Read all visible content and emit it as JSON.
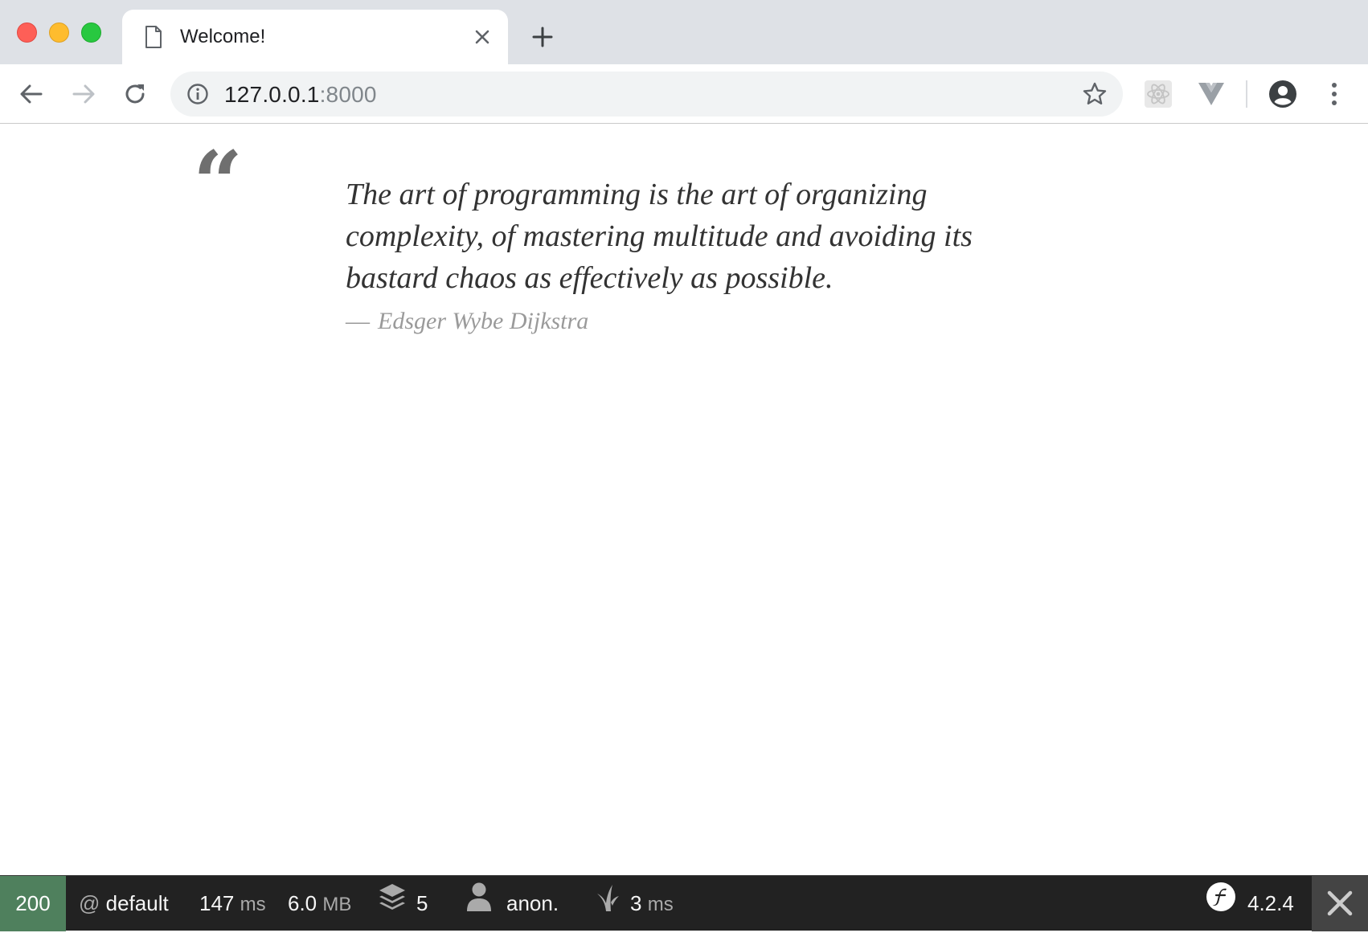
{
  "tab": {
    "title": "Welcome!"
  },
  "address_bar": {
    "host": "127.0.0.1",
    "port": ":8000"
  },
  "quote": {
    "text": "The art of programming is the art of organizing complexity, of mastering multitude and avoiding its bastard chaos as effectively as possible.",
    "dash": "—",
    "author": "Edsger Wybe Dijkstra"
  },
  "debug_toolbar": {
    "status_code": "200",
    "route_prefix": "@",
    "route": "default",
    "time_value": "147",
    "time_unit": "ms",
    "memory_value": "6.0",
    "memory_unit": "MB",
    "templates_count": "5",
    "user": "anon.",
    "twig_time_value": "3",
    "twig_time_unit": "ms",
    "symfony_version": "4.2.4"
  },
  "colors": {
    "tabstrip_bg": "#dee1e6",
    "status_success": "#4f805d",
    "debug_bar_bg": "#222222"
  }
}
